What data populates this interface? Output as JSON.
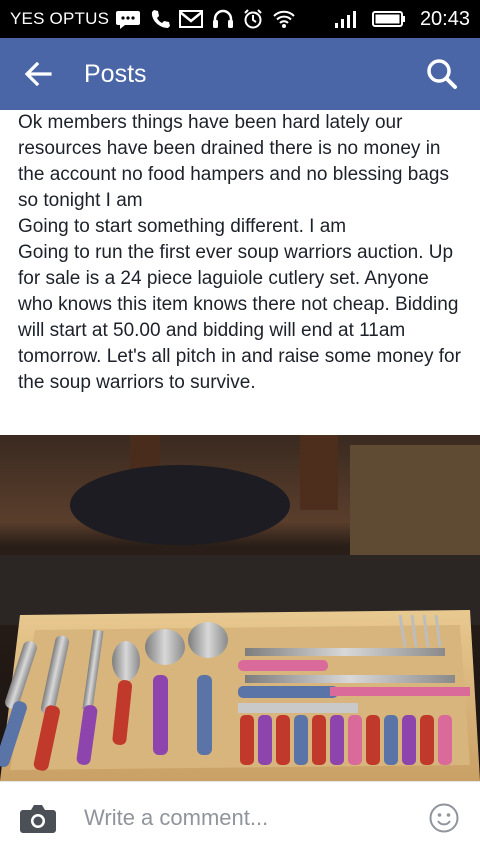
{
  "status_bar": {
    "carrier": "YES OPTUS",
    "time": "20:43",
    "icons": [
      "message-icon",
      "phone-icon",
      "gmail-icon",
      "headset-icon",
      "alarm-icon",
      "wifi-icon",
      "signal-icon",
      "battery-icon"
    ]
  },
  "app_bar": {
    "title": "Posts",
    "back_icon": "arrow-left-icon",
    "search_icon": "search-icon",
    "background_color": "#4a66a6"
  },
  "post": {
    "text": "Ok members things have been hard lately our resources have been drained there is no money in the account no food hampers and no blessing bags so tonight I am\nGoing to start something different. I am\nGoing to run the first ever soup warriors auction. Up for sale is a 24 piece laguiole cutlery set. Anyone who knows this item knows there not cheap. Bidding will start at 50.00 and bidding will end at 11am tomorrow. Let's all pitch in and raise some money for the soup warriors to survive."
  },
  "comment_bar": {
    "placeholder": "Write a comment...",
    "camera_icon": "camera-icon",
    "emoji_icon": "emoji-icon"
  }
}
